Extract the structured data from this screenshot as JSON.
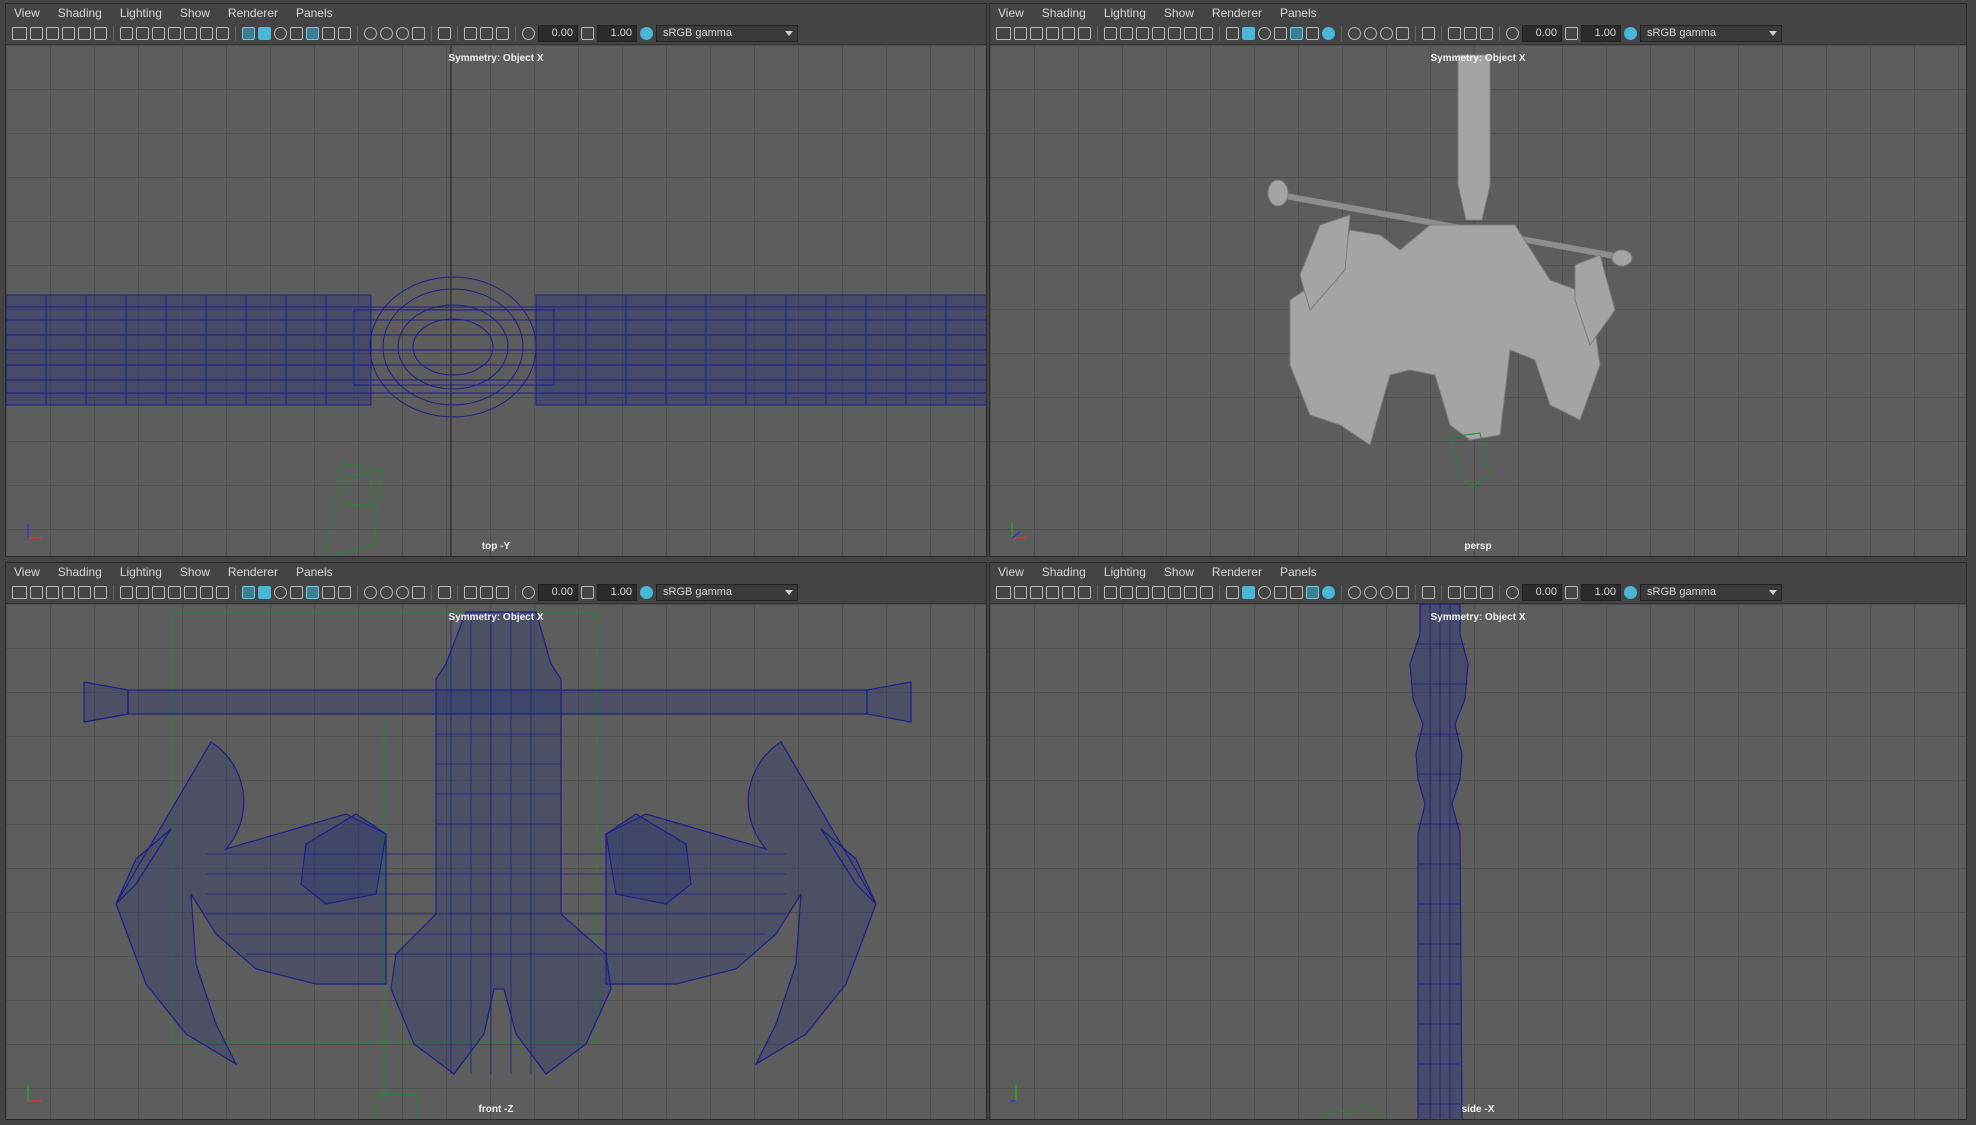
{
  "menus": [
    "View",
    "Shading",
    "Lighting",
    "Show",
    "Renderer",
    "Panels"
  ],
  "toolbar": {
    "exposure": "0.00",
    "gamma": "1.00",
    "color_space": "sRGB gamma"
  },
  "panes": [
    {
      "id": "top",
      "symmetry": "Symmetry: Object X",
      "camera": "top -Y"
    },
    {
      "id": "persp",
      "symmetry": "Symmetry: Object X",
      "camera": "persp"
    },
    {
      "id": "front",
      "symmetry": "Symmetry: Object X",
      "camera": "front -Z"
    },
    {
      "id": "side",
      "symmetry": "Symmetry: Object X",
      "camera": "side -X"
    }
  ],
  "colors": {
    "wireframe": "#1a1f8c",
    "shaded_mesh": "#a4a4a4",
    "locator": "#1f8a2a",
    "active_icon": "#49b7d8"
  },
  "icons": [
    "camera-icon",
    "grid-icon",
    "wireframe-icon",
    "smooth-shade-icon",
    "textured-icon",
    "light-icon",
    "xray-icon",
    "isolate-icon",
    "color-management-icon"
  ]
}
